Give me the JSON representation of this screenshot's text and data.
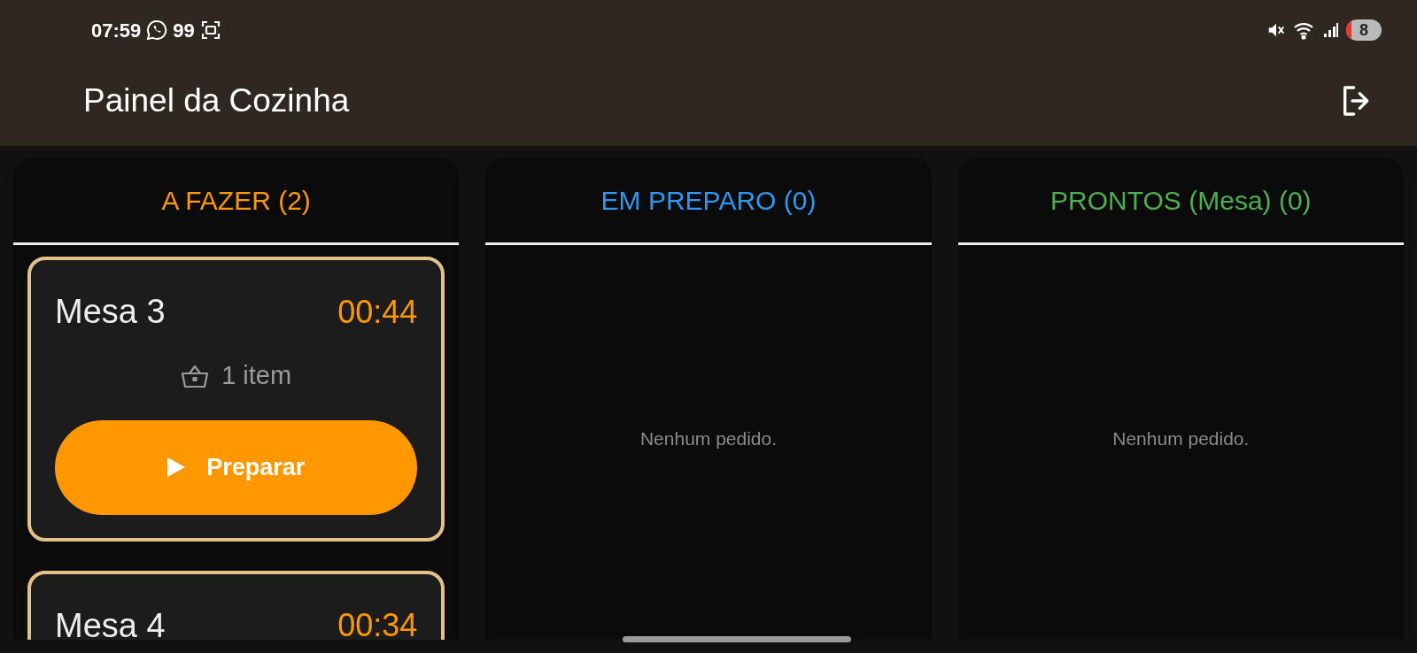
{
  "status_bar": {
    "time": "07:59",
    "notification_count": "99",
    "battery": "8"
  },
  "app_bar": {
    "title": "Painel da Cozinha"
  },
  "columns": [
    {
      "title": "A FAZER (2)",
      "kind": "todo",
      "cards": [
        {
          "table": "Mesa 3",
          "timer": "00:44",
          "items": "1 item",
          "button": "Preparar"
        },
        {
          "table": "Mesa 4",
          "timer": "00:34"
        }
      ]
    },
    {
      "title": "EM PREPARO (0)",
      "kind": "preparing",
      "empty_text": "Nenhum pedido."
    },
    {
      "title": "PRONTOS (Mesa) (0)",
      "kind": "ready",
      "empty_text": "Nenhum pedido."
    }
  ]
}
